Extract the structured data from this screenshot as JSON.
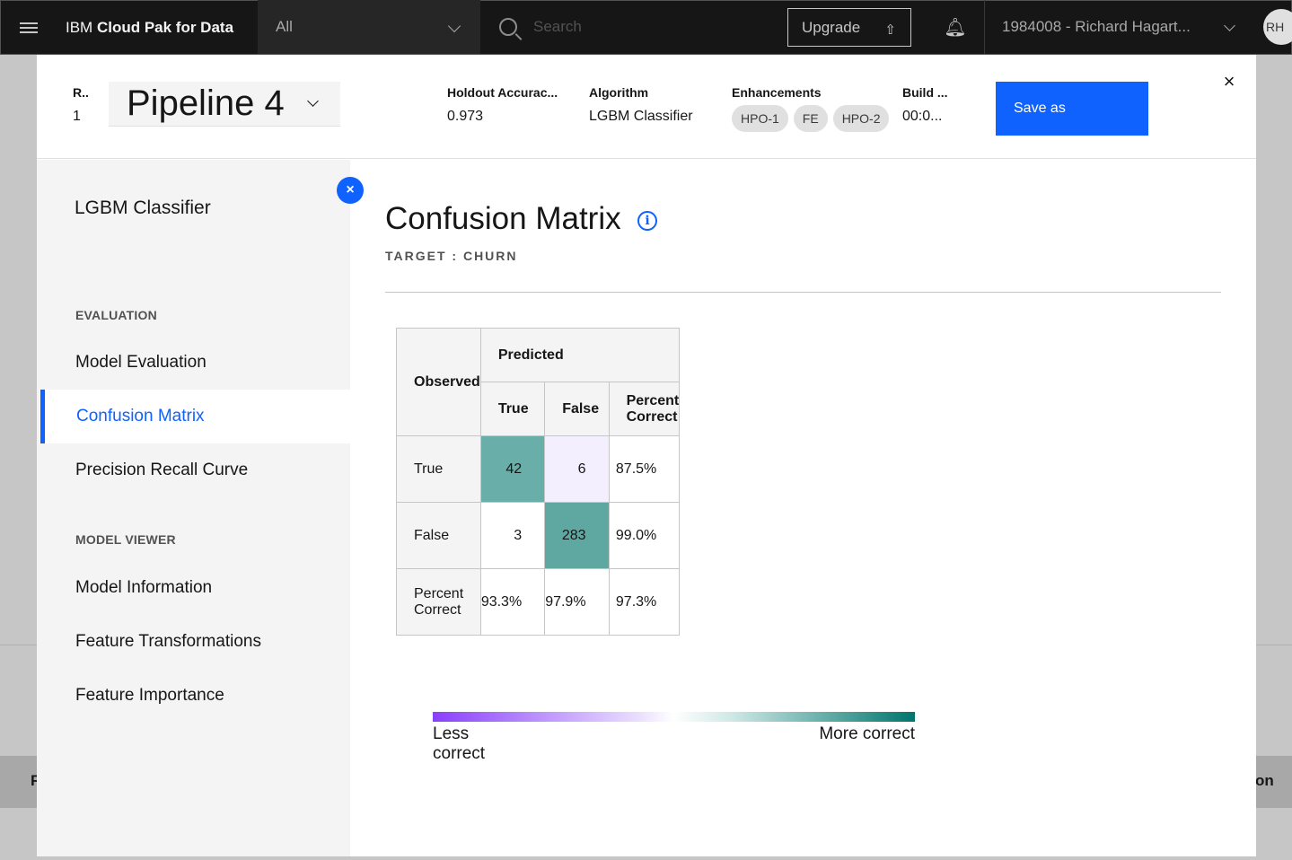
{
  "header": {
    "brand_prefix": "IBM ",
    "brand_name": "Cloud Pak for Data",
    "scope_value": "All",
    "search_placeholder": "Search",
    "upgrade_label": "Upgrade",
    "account_label": "1984008 - Richard Hagart...",
    "avatar_initials": "RH"
  },
  "background": {
    "left_fragment": "F",
    "right_fragment": "on"
  },
  "modal": {
    "rank_label": "R..",
    "rank_value": "1",
    "pipeline_name": "Pipeline 4",
    "metrics": [
      {
        "label": "Holdout Accurac...",
        "value": "0.973"
      },
      {
        "label": "Algorithm",
        "value": "LGBM Classifier"
      },
      {
        "label": "Enhancements",
        "tags": [
          "HPO-1",
          "FE",
          "HPO-2"
        ]
      },
      {
        "label": "Build ...",
        "value": "00:0..."
      }
    ],
    "save_label": "Save as",
    "close_icon": "×"
  },
  "sidebar": {
    "title": "LGBM Classifier",
    "sections": [
      {
        "label": "EVALUATION",
        "items": [
          "Model Evaluation",
          "Confusion Matrix",
          "Precision Recall Curve"
        ]
      },
      {
        "label": "MODEL VIEWER",
        "items": [
          "Model Information",
          "Feature Transformations",
          "Feature Importance"
        ]
      }
    ],
    "active_item": "Confusion Matrix",
    "collapse_icon": "×"
  },
  "main": {
    "title": "Confusion Matrix",
    "info_icon": "i",
    "target_label": "TARGET : CHURN",
    "matrix": {
      "observed_label": "Observed",
      "predicted_label": "Predicted",
      "columns": [
        "True",
        "False",
        "Percent Correct"
      ],
      "rows": [
        {
          "label": "True",
          "cells": [
            "42",
            "6",
            "87.5%"
          ]
        },
        {
          "label": "False",
          "cells": [
            "3",
            "283",
            "99.0%"
          ]
        },
        {
          "label": "Percent Correct",
          "cells": [
            "93.3%",
            "97.9%",
            "97.3%"
          ]
        }
      ]
    },
    "legend": {
      "less_label": "Less correct",
      "more_label": "More correct",
      "low_color": "#8a3ffc",
      "high_color": "#00756e"
    }
  },
  "colors": {
    "accent": "#0f62fe",
    "topbar": "#161616"
  }
}
